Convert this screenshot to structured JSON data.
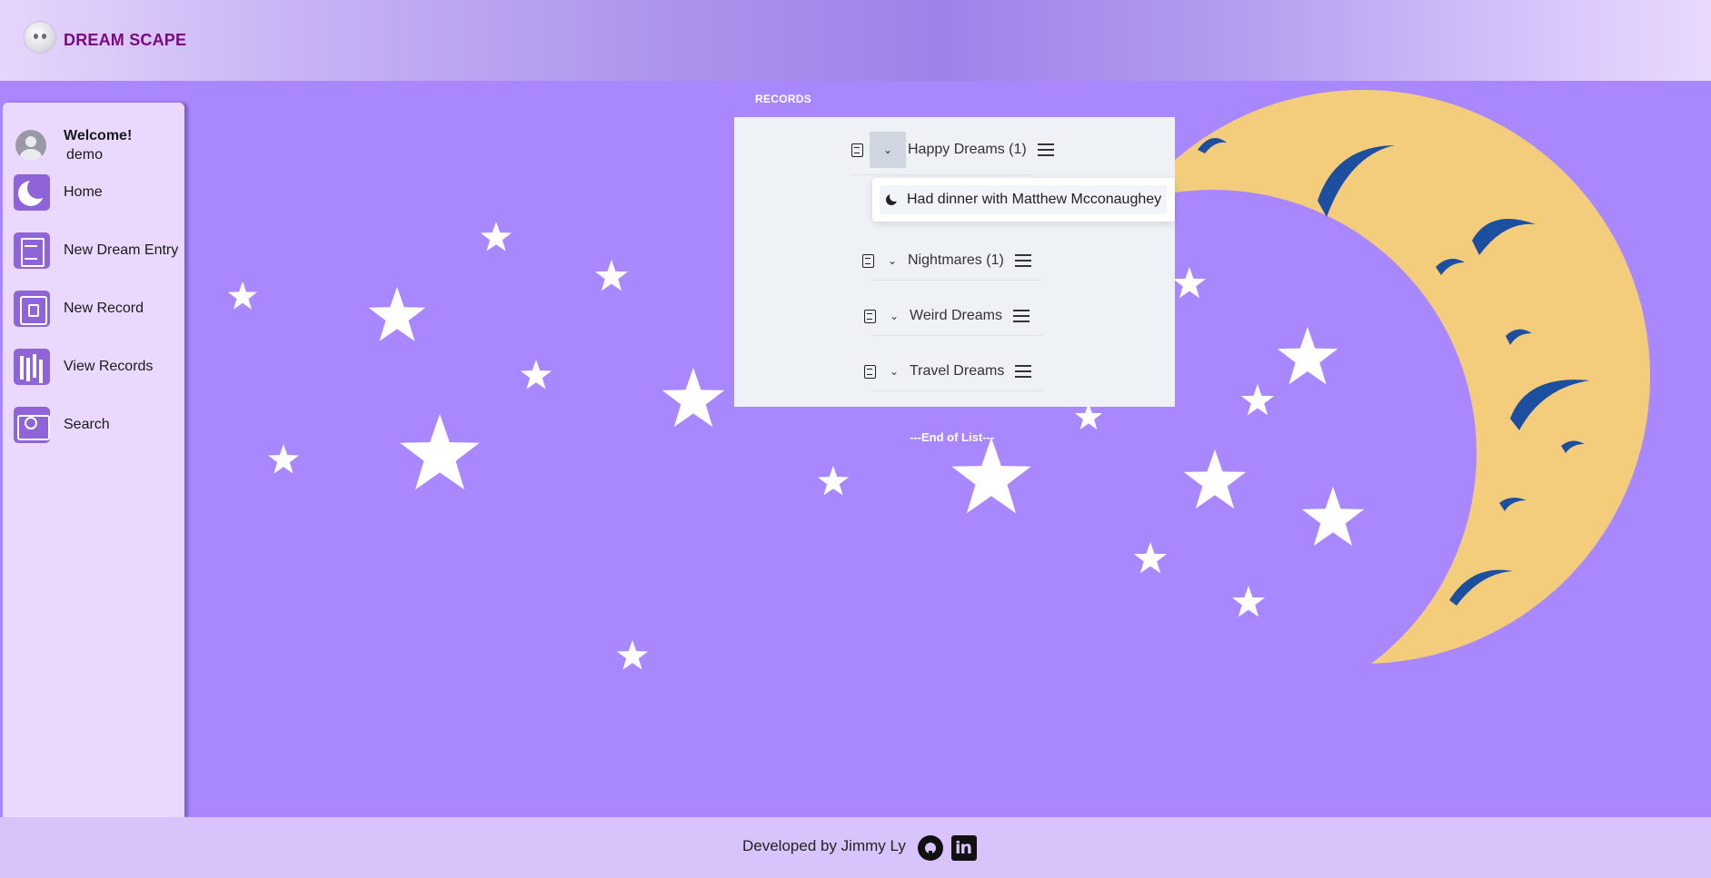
{
  "app": {
    "brand": "DREAM SCAPE"
  },
  "user": {
    "greeting": "Welcome!",
    "name": "demo"
  },
  "sidebar": {
    "items": [
      {
        "label": "Home",
        "icon": "moon-icon"
      },
      {
        "label": "New Dream Entry",
        "icon": "document-icon"
      },
      {
        "label": "New Record",
        "icon": "book-icon"
      },
      {
        "label": "View Records",
        "icon": "books-icon"
      },
      {
        "label": "Search",
        "icon": "book-search-icon"
      }
    ]
  },
  "records": {
    "title": "RECORDS",
    "items": [
      {
        "label": "Happy Dreams (1)",
        "expanded": true
      },
      {
        "label": "Nightmares (1)",
        "expanded": false
      },
      {
        "label": "Weird Dreams",
        "expanded": false
      },
      {
        "label": "Travel Dreams",
        "expanded": false
      }
    ],
    "dropdown_entry": "Had dinner with Matthew Mcconaughey",
    "end_text": "---End of List---"
  },
  "footer": {
    "text": "Developed by Jimmy Ly"
  },
  "colors": {
    "background": "#a988ff",
    "sidebar": "#ead9fd",
    "moon": "#f4cd7c",
    "crater": "#1c4fa0",
    "brand": "#7a0a84"
  }
}
